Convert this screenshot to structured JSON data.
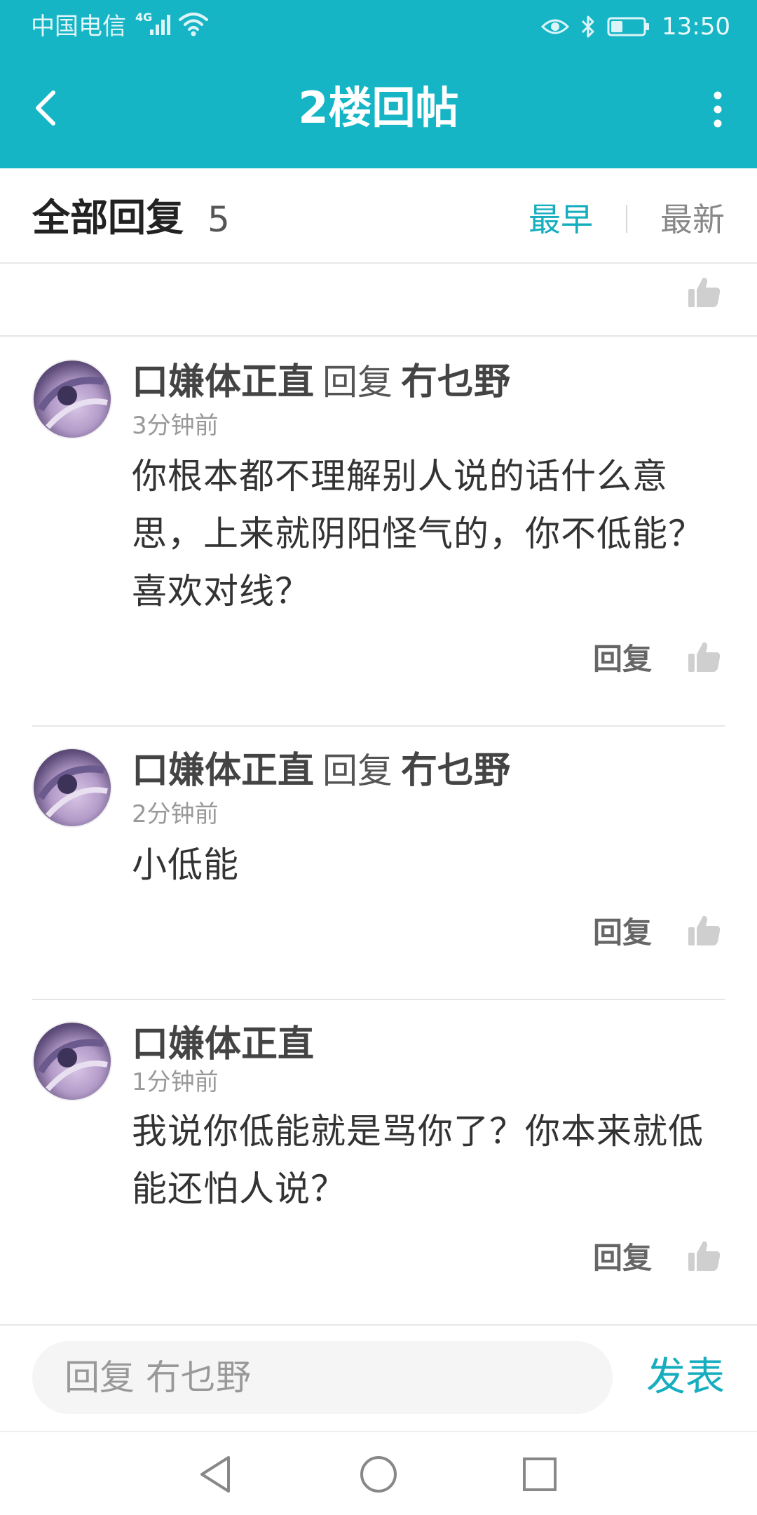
{
  "status_bar": {
    "carrier": "中国电信",
    "network_type": "4G",
    "time": "13:50"
  },
  "header": {
    "title": "2楼回帖",
    "back_icon": "back-chevron-icon",
    "more_icon": "more-vertical-icon",
    "background_color": "#16b5c6"
  },
  "replies_header": {
    "title": "全部回复",
    "count": "5",
    "sort_earliest": "最早",
    "sort_newest": "最新",
    "active_sort": "最早",
    "accent_color": "#16aebf"
  },
  "replies": [
    {
      "author": "口嫌体正直",
      "reply_word": "回复",
      "target": "冇乜野",
      "time": "3分钟前",
      "text": "你根本都不理解别人说的话什么意思，上来就阴阳怪气的，你不低能？喜欢对线？",
      "action": "回复"
    },
    {
      "author": "口嫌体正直",
      "reply_word": "回复",
      "target": "冇乜野",
      "time": "2分钟前",
      "text": "小低能",
      "action": "回复"
    },
    {
      "author": "口嫌体正直",
      "reply_word": "",
      "target": "",
      "time": "1分钟前",
      "text": "我说你低能就是骂你了？你本来就低能还怕人说？",
      "action": "回复"
    }
  ],
  "input_bar": {
    "placeholder": "回复 冇乜野",
    "publish_label": "发表"
  },
  "system_nav": {
    "back": "nav-back-icon",
    "home": "nav-home-icon",
    "recents": "nav-recents-icon"
  }
}
